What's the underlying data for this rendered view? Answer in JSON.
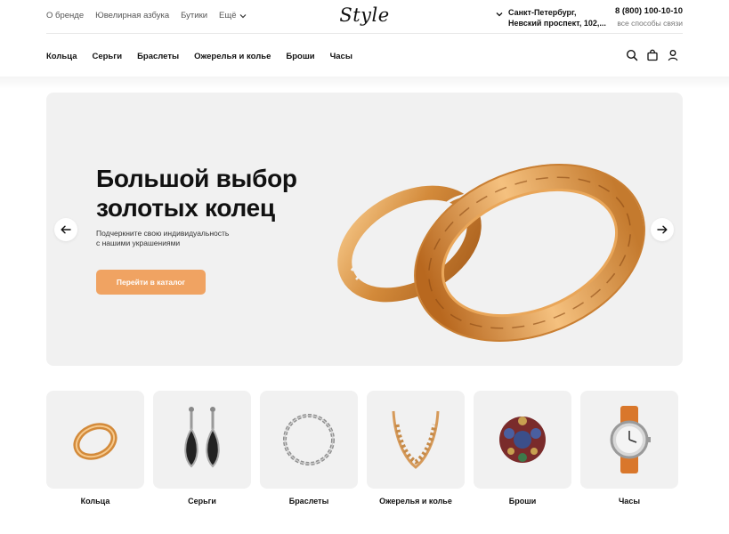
{
  "topbar": {
    "links": [
      "О бренде",
      "Ювелирная азбука",
      "Бутики",
      "Ещё"
    ],
    "logo": "Style",
    "city_line1": "Санкт-Петербург,",
    "city_line2": "Невский проспект, 102,...",
    "phone": "8 (800) 100-10-10",
    "contact_ways": "все способы связи"
  },
  "nav": {
    "items": [
      "Кольца",
      "Серьги",
      "Браслеты",
      "Ожерелья и колье",
      "Броши",
      "Часы"
    ],
    "icons": [
      "search-icon",
      "bag-icon",
      "user-icon"
    ]
  },
  "hero": {
    "title_line1": "Большой выбор",
    "title_line2": "золотых колец",
    "subtitle_line1": "Подчеркните свою индивидуальность",
    "subtitle_line2": "с нашими украшениями",
    "cta": "Перейти в каталог"
  },
  "categories": [
    {
      "label": "Кольца",
      "icon": "ring-icon"
    },
    {
      "label": "Серьги",
      "icon": "earrings-icon"
    },
    {
      "label": "Браслеты",
      "icon": "bracelet-icon"
    },
    {
      "label": "Ожерелья и колье",
      "icon": "necklace-icon"
    },
    {
      "label": "Броши",
      "icon": "brooch-icon"
    },
    {
      "label": "Часы",
      "icon": "watch-icon"
    }
  ],
  "colors": {
    "accent": "#f0a362",
    "gold": "#d38a3a",
    "tile_bg": "#f1f1f1"
  }
}
